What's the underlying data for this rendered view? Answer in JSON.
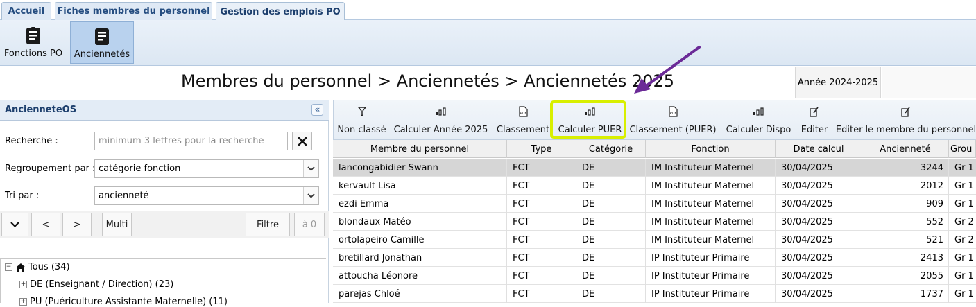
{
  "tabs": [
    {
      "label": "Accueil"
    },
    {
      "label": "Fiches membres du personnel"
    },
    {
      "label": "Gestion des emplois PO"
    }
  ],
  "ribbon": {
    "buttons": [
      {
        "label": "Fonctions PO",
        "icon": "document-list-icon"
      },
      {
        "label": "Anciennetés",
        "icon": "document-list-icon"
      }
    ]
  },
  "breadcrumb": "Membres du personnel > Anciennetés > Anciennetés 2025",
  "year_button": "Année 2024-2025",
  "left_panel": {
    "title": "AncienneteOS",
    "search_label": "Recherche :",
    "search_placeholder": "minimum 3 lettres pour la recherche",
    "group_label": "Regroupement par :",
    "group_value": "catégorie fonction",
    "sort_label": "Tri par :",
    "sort_value": "ancienneté",
    "nav": {
      "prev": "<",
      "next": ">",
      "multi": "Multi",
      "filter": "Filtre",
      "reset": "à 0"
    },
    "tree": [
      {
        "label": "Tous (34)"
      },
      {
        "label": "DE (Enseignant / Direction) (23)"
      },
      {
        "label": "PU (Puériculture Assistante Maternelle) (11)"
      }
    ]
  },
  "toolbar": [
    {
      "label": "Non classé",
      "icon": "filter-icon"
    },
    {
      "label": "Calculer Année 2025",
      "icon": "bar-chart-icon"
    },
    {
      "label": "Classement",
      "icon": "pdf-icon"
    },
    {
      "label": "Calculer PUER",
      "icon": "bar-chart-icon"
    },
    {
      "label": "Classement (PUER)",
      "icon": "pdf-icon"
    },
    {
      "label": "Calculer Dispo",
      "icon": "bar-chart-icon"
    },
    {
      "label": "Editer",
      "icon": "edit-icon"
    },
    {
      "label": "Editer le membre du personnel",
      "icon": "edit-icon"
    }
  ],
  "table": {
    "columns": [
      "Membre du personnel",
      "Type",
      "Catégorie",
      "Fonction",
      "Date calcul",
      "Ancienneté",
      "Grou"
    ],
    "rows": [
      [
        "lancongabidier Swann",
        "FCT",
        "DE",
        "IM Instituteur Maternel",
        "30/04/2025",
        "3244",
        "Gr 1"
      ],
      [
        "kervault Lisa",
        "FCT",
        "DE",
        "IM Instituteur Maternel",
        "30/04/2025",
        "2012",
        "Gr 1"
      ],
      [
        "ezdi Emma",
        "FCT",
        "DE",
        "IM Instituteur Maternel",
        "30/04/2025",
        "909",
        "Gr 1"
      ],
      [
        "blondaux Matéo",
        "FCT",
        "DE",
        "IM Instituteur Maternel",
        "30/04/2025",
        "552",
        "Gr 2"
      ],
      [
        "ortolapeiro Camille",
        "FCT",
        "DE",
        "IM Instituteur Maternel",
        "30/04/2025",
        "521",
        "Gr 2"
      ],
      [
        "bretillard Jonathan",
        "FCT",
        "DE",
        "IP Instituteur Primaire",
        "30/04/2025",
        "2413",
        "Gr 1"
      ],
      [
        "attoucha Léonore",
        "FCT",
        "DE",
        "IP Instituteur Primaire",
        "30/04/2025",
        "2055",
        "Gr 1"
      ],
      [
        "parejas Chloé",
        "FCT",
        "DE",
        "IP Instituteur Primaire",
        "30/04/2025",
        "1737",
        "Gr 1"
      ]
    ]
  },
  "colors": {
    "highlight": "#d8ef00",
    "annotation_arrow": "#6b2a97",
    "selected_row": "#d6d6d6"
  }
}
